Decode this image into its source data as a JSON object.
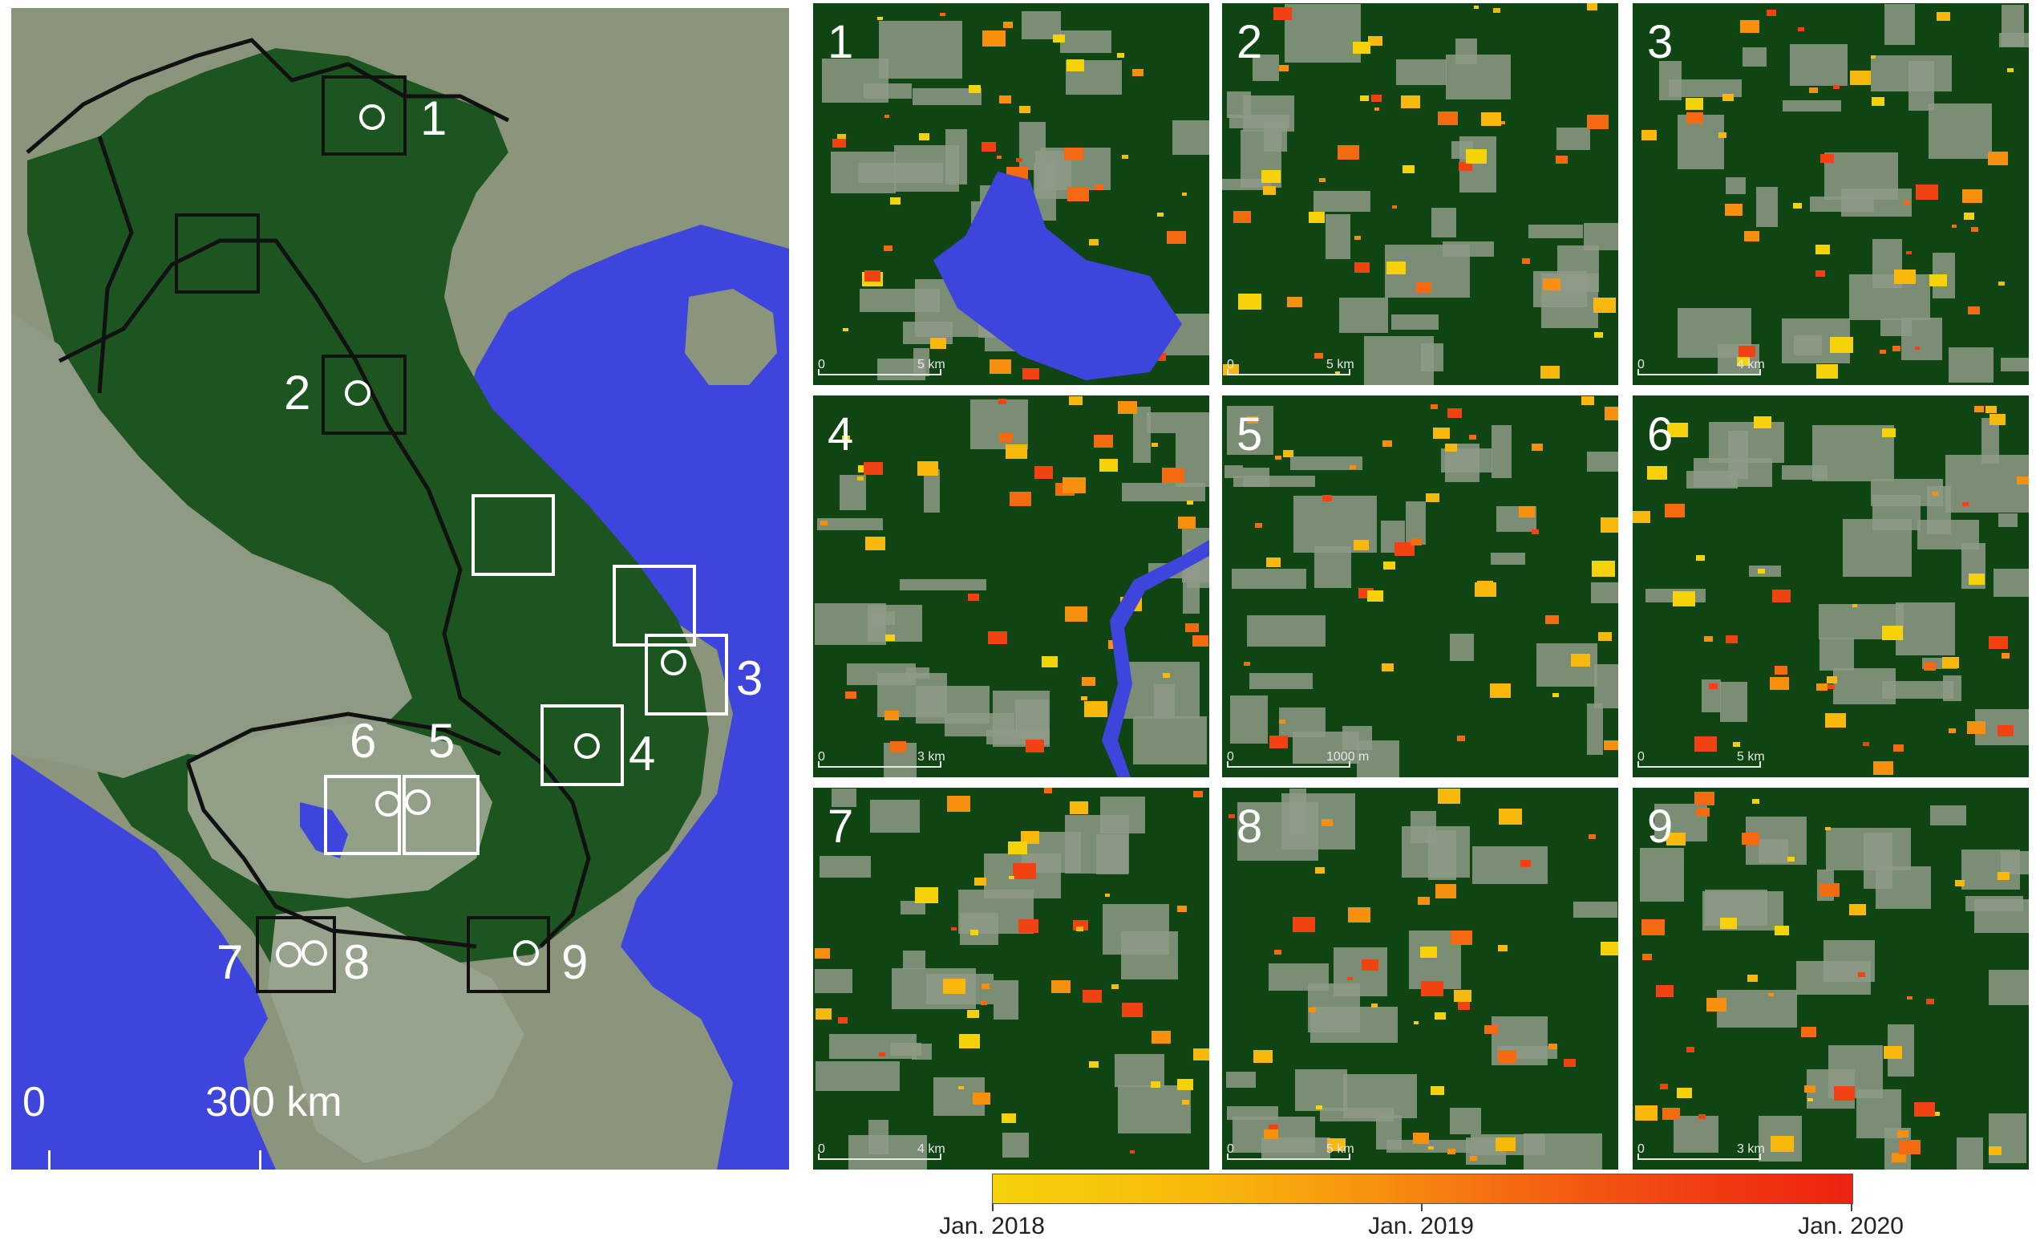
{
  "overview": {
    "site_labels": [
      "1",
      "2",
      "3",
      "4",
      "5",
      "6",
      "7",
      "8",
      "9"
    ],
    "scale_zero": "0",
    "scale_distance": "300 km"
  },
  "panels": [
    {
      "number": "1",
      "scale_zero": "0",
      "scale_distance": "5 km"
    },
    {
      "number": "2",
      "scale_zero": "0",
      "scale_distance": "5 km"
    },
    {
      "number": "3",
      "scale_zero": "0",
      "scale_distance": "4 km"
    },
    {
      "number": "4",
      "scale_zero": "0",
      "scale_distance": "3 km"
    },
    {
      "number": "5",
      "scale_zero": "0",
      "scale_distance": "1000 m"
    },
    {
      "number": "6",
      "scale_zero": "0",
      "scale_distance": "5 km"
    },
    {
      "number": "7",
      "scale_zero": "0",
      "scale_distance": "4 km"
    },
    {
      "number": "8",
      "scale_zero": "0",
      "scale_distance": "5 km"
    },
    {
      "number": "9",
      "scale_zero": "0",
      "scale_distance": "3 km"
    }
  ],
  "colorbar": {
    "labels": [
      "Jan. 2018",
      "Jan. 2019",
      "Jan. 2020"
    ],
    "colors": [
      "#f5d20a",
      "#f7900e",
      "#ee2210"
    ]
  },
  "colors": {
    "forest": "#0f4513",
    "water": "#3d45dc",
    "nonforest": "#8a9680",
    "boundary": "#111111",
    "box_black": "#111111",
    "box_white": "#ffffff"
  }
}
